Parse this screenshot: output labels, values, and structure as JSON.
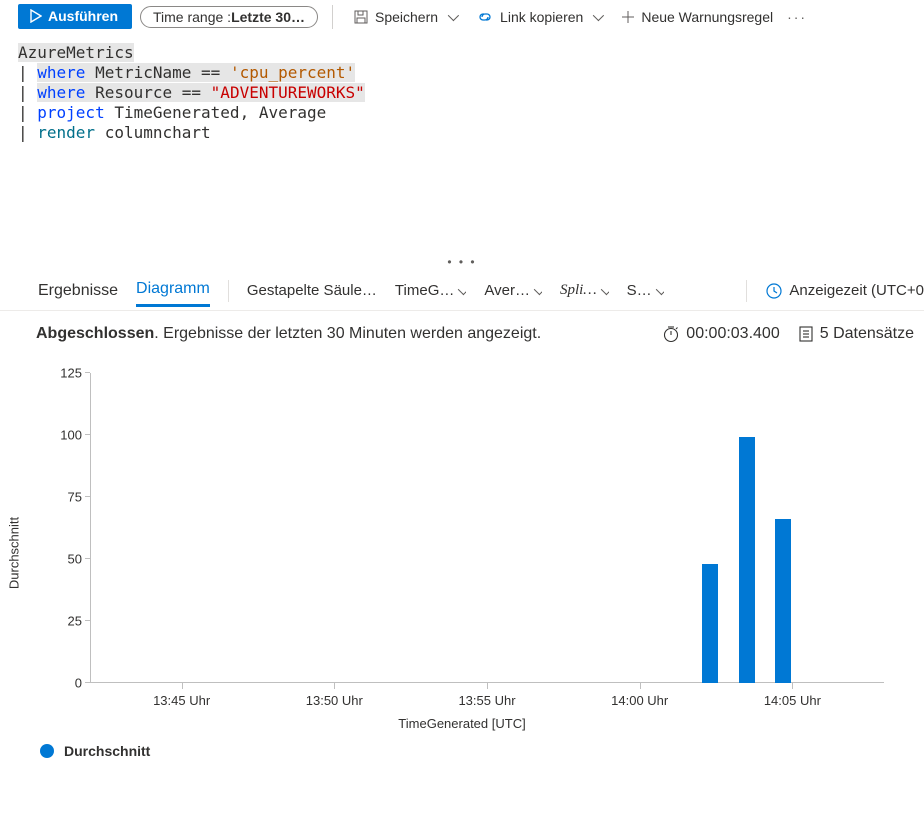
{
  "toolbar": {
    "run_label": "Ausführen",
    "timerange_prefix": "Time range : ",
    "timerange_value": "Letzte 30…",
    "save_label": "Speichern",
    "copylink_label": "Link kopieren",
    "new_alert_label": "Neue Warnungsregel"
  },
  "query": {
    "table": "AzureMetrics",
    "line1_kw": "where",
    "line1_body_a": " MetricName == ",
    "line1_str": "'cpu_percent'",
    "line2_kw": "where",
    "line2_body_a": " Resource == ",
    "line2_str": "\"ADVENTUREWORKS\"",
    "line3_kw": "project",
    "line3_body": " TimeGenerated, Average",
    "line4_kw": "render",
    "line4_body": " columnchart"
  },
  "tabs": {
    "results": "Ergebnisse",
    "chart": "Diagramm",
    "charttype": "Gestapelte Säule…",
    "xcol": "TimeG…",
    "ycol": "Aver…",
    "split": "Spli…",
    "agg": "S…",
    "display_time": "Anzeigezeit (UTC+0"
  },
  "status": {
    "done": "Abgeschlossen",
    "msg": ". Ergebnisse der letzten 30 Minuten werden angezeigt.",
    "elapsed": "00:00:03.400",
    "records": "5 Datensätze"
  },
  "chart_data": {
    "type": "bar",
    "title": "",
    "ylabel": "Durchschnitt",
    "xlabel": "TimeGenerated [UTC]",
    "ylim": [
      0,
      125
    ],
    "yticks": [
      0,
      25,
      50,
      75,
      100,
      125
    ],
    "x_range_minutes": [
      42,
      68
    ],
    "x_ticks": [
      {
        "min": 45,
        "label": "13:45 Uhr"
      },
      {
        "min": 50,
        "label": "13:50 Uhr"
      },
      {
        "min": 55,
        "label": "13:55 Uhr"
      },
      {
        "min": 60,
        "label": "14:00 Uhr"
      },
      {
        "min": 65,
        "label": "14:05 Uhr"
      }
    ],
    "series": [
      {
        "name": "Durchschnitt",
        "points": [
          {
            "min": 62.3,
            "value": 48
          },
          {
            "min": 63.5,
            "value": 99
          },
          {
            "min": 64.7,
            "value": 66
          }
        ]
      }
    ]
  },
  "legend": {
    "label": "Durchschnitt"
  }
}
